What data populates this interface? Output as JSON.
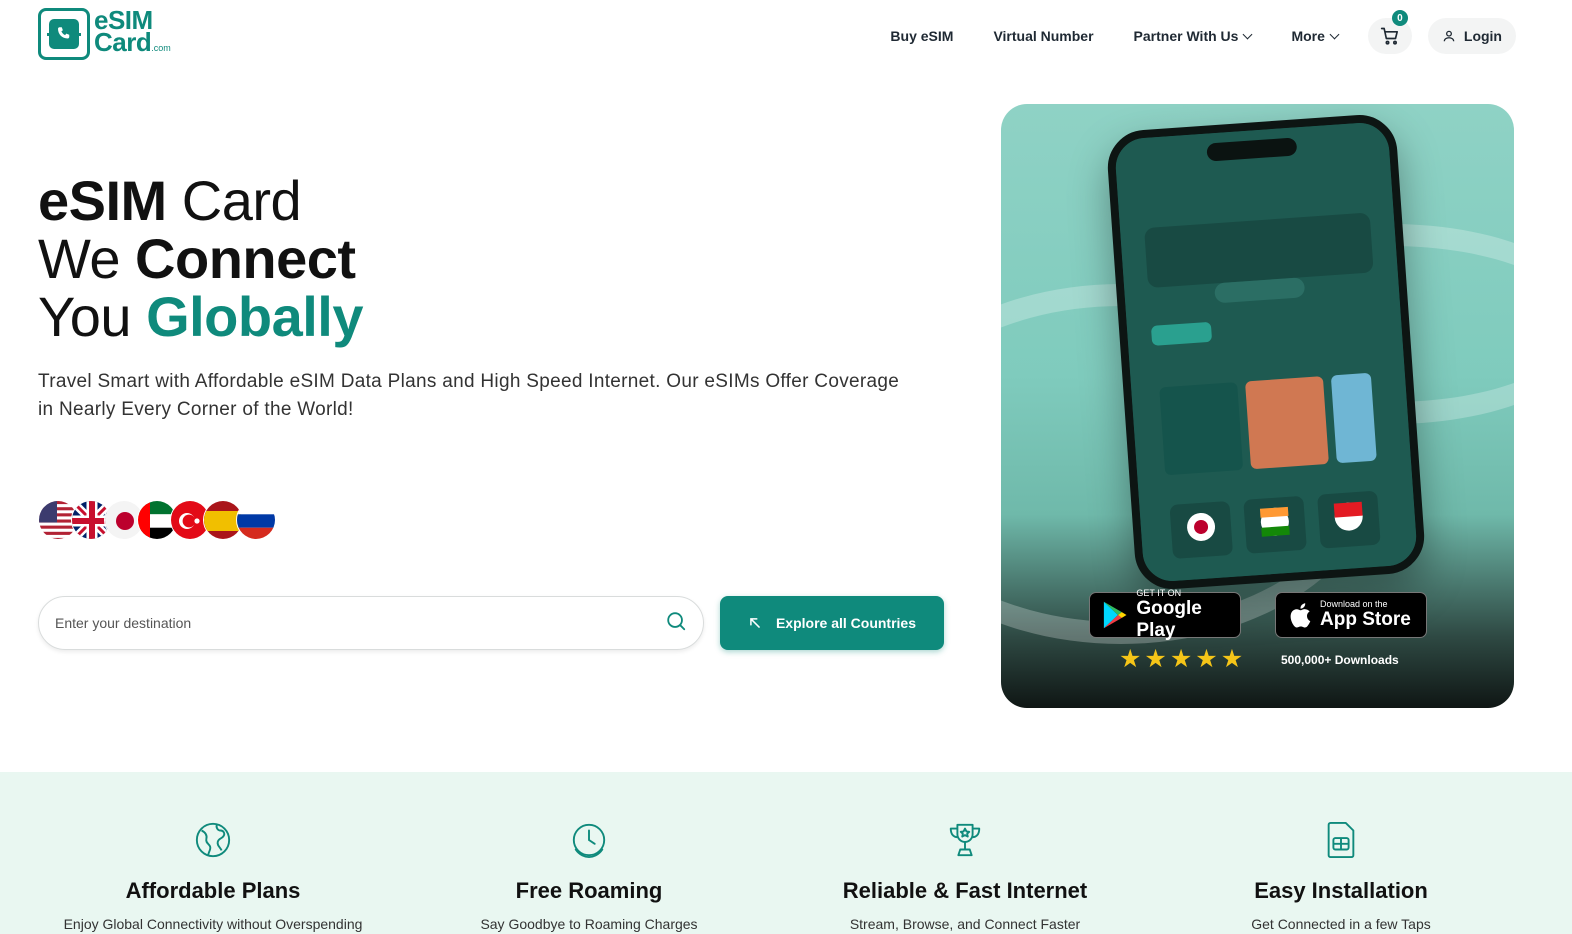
{
  "brand": {
    "logo_main": "eSIM",
    "logo_sub": "Card",
    "logo_domain": ".com",
    "accent_color": "#0f8a7c"
  },
  "nav": {
    "items": [
      {
        "label": "Buy eSIM"
      },
      {
        "label": "Virtual Number"
      },
      {
        "label": "Partner With Us"
      },
      {
        "label": "More"
      }
    ],
    "cart_count": "0",
    "login_label": "Login"
  },
  "hero": {
    "line1_bold": "eSIM",
    "line1_rest": " Card",
    "line2_plain": "We ",
    "line2_bold": "Connect",
    "line3_plain": "You ",
    "line3_green": "Globally",
    "subtitle": "Travel Smart with Affordable eSIM Data Plans and High Speed Internet. Our eSIMs Offer Coverage in Nearly Every Corner of the World!",
    "flags": [
      "us-flag",
      "uk-flag",
      "japan-flag",
      "uae-flag",
      "turkey-flag",
      "spain-flag",
      "russia-flag"
    ],
    "search_placeholder": "Enter your destination",
    "explore_label": "Explore all Countries"
  },
  "promo": {
    "google_small": "GET IT ON",
    "google_big": "Google Play",
    "apple_small": "Download on the",
    "apple_big": "App Store",
    "rating_stars": 5,
    "downloads": "500,000+ Downloads"
  },
  "features": [
    {
      "icon": "globe-icon",
      "title": "Affordable Plans",
      "desc": "Enjoy Global Connectivity without Overspending"
    },
    {
      "icon": "clock-icon",
      "title": "Free Roaming",
      "desc": "Say Goodbye to Roaming Charges"
    },
    {
      "icon": "trophy-icon",
      "title": "Reliable & Fast Internet",
      "desc": "Stream, Browse, and Connect Faster"
    },
    {
      "icon": "sim-card-icon",
      "title": "Easy Installation",
      "desc": "Get Connected in a few Taps"
    }
  ]
}
